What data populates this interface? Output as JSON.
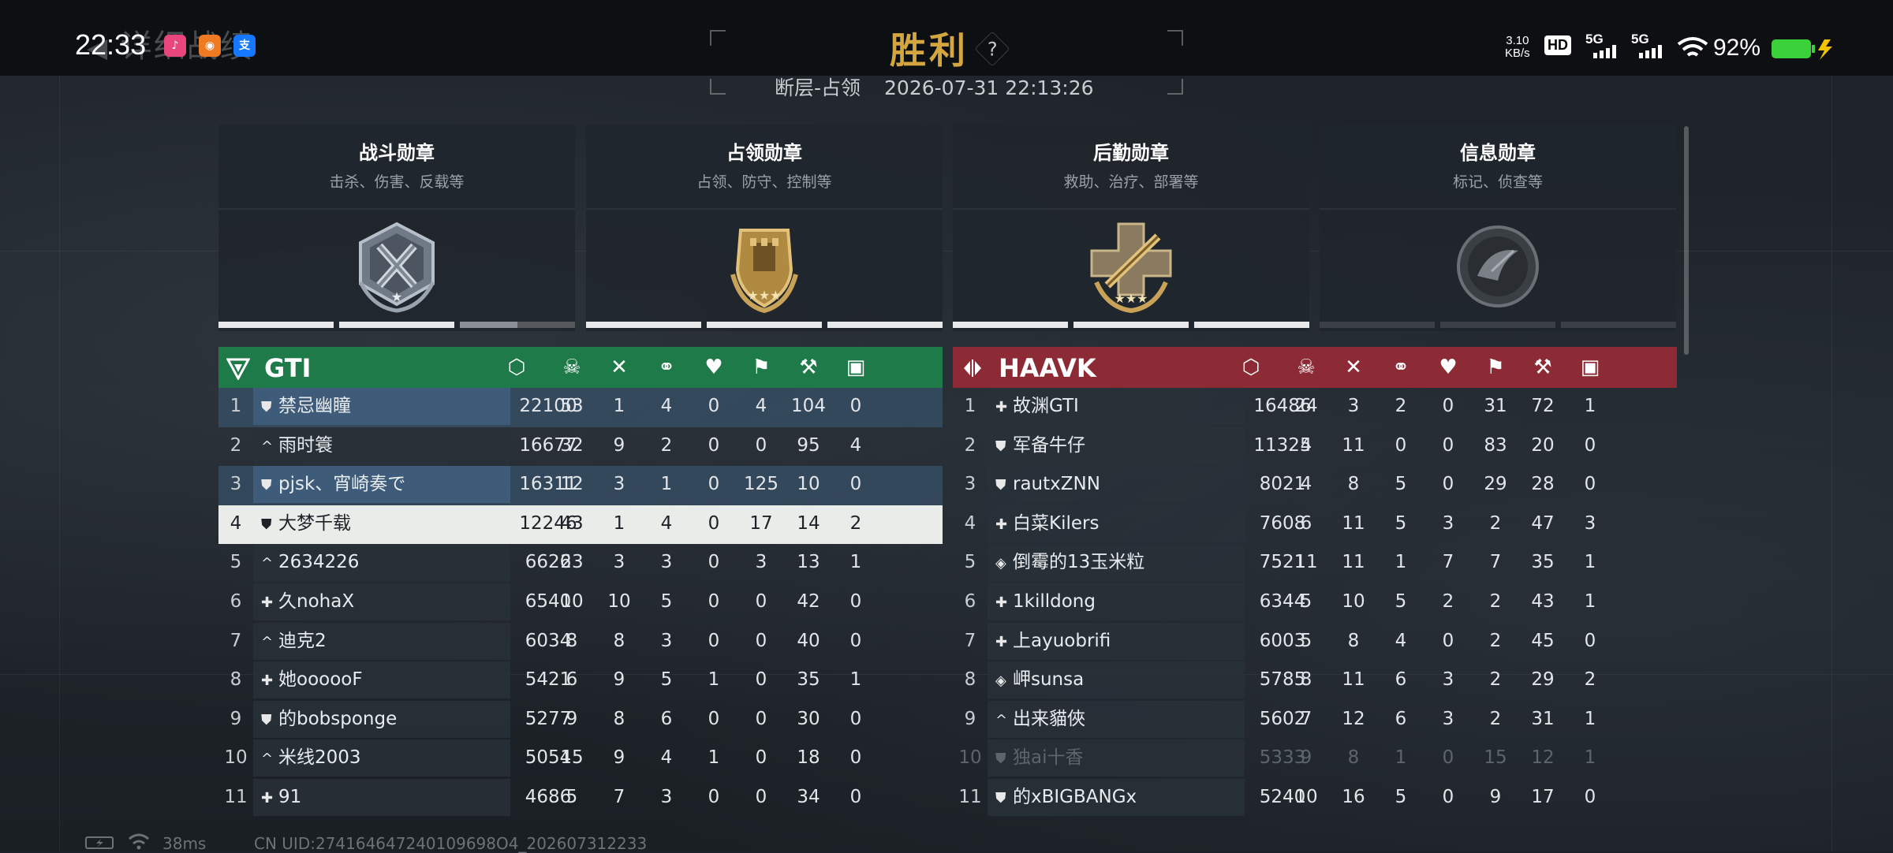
{
  "status_bar": {
    "time": "22:33",
    "speed_value": "3.10",
    "speed_unit": "KB/s",
    "hd": "HD",
    "net1": "5G",
    "net2": "5G",
    "battery": "92%"
  },
  "header": {
    "back_label": "详细战绩",
    "title": "胜利",
    "help": "?",
    "map_mode": "断层-占领",
    "datetime": "2026-07-31 22:13:26"
  },
  "medals": [
    {
      "name": "战斗勋章",
      "desc": "击杀、伤害、反载等",
      "progress": [
        1,
        1,
        0.5
      ]
    },
    {
      "name": "占领勋章",
      "desc": "占领、防守、控制等",
      "progress": [
        1,
        1,
        1
      ]
    },
    {
      "name": "后勤勋章",
      "desc": "救助、治疗、部署等",
      "progress": [
        1,
        1,
        1
      ]
    },
    {
      "name": "信息勋章",
      "desc": "标记、侦查等",
      "progress": [
        0,
        0,
        0
      ]
    }
  ],
  "stat_icons": [
    "score-icon",
    "kills-icon",
    "deaths-icon",
    "assists-icon",
    "revives-icon",
    "capture-icon",
    "objective-icon",
    "intel-icon"
  ],
  "colors": {
    "team_left": "#1f7a4a",
    "team_right": "#8c2a35",
    "title_gold": "#d4a640",
    "highlight_blue": "#3e5c7a"
  },
  "team_left": {
    "name": "GTI",
    "rows": [
      {
        "rank": "1",
        "cls": "shield",
        "name": "禁忌幽瞳",
        "stats": [
          "22100",
          "53",
          "1",
          "4",
          "0",
          "4",
          "104",
          "0"
        ],
        "hl": "blue"
      },
      {
        "rank": "2",
        "cls": "caret",
        "name": "雨时簑",
        "stats": [
          "16677",
          "32",
          "9",
          "2",
          "0",
          "0",
          "95",
          "4"
        ],
        "hl": ""
      },
      {
        "rank": "3",
        "cls": "shield",
        "name": "pjsk、宵崎奏で",
        "stats": [
          "16311",
          "12",
          "3",
          "1",
          "0",
          "125",
          "10",
          "0"
        ],
        "hl": "blue"
      },
      {
        "rank": "4",
        "cls": "shield",
        "name": "大梦千载",
        "stats": [
          "12246",
          "43",
          "1",
          "4",
          "0",
          "17",
          "14",
          "2"
        ],
        "hl": "white"
      },
      {
        "rank": "5",
        "cls": "caret",
        "name": "2634226",
        "stats": [
          "6626",
          "23",
          "3",
          "3",
          "0",
          "3",
          "13",
          "1"
        ],
        "hl": ""
      },
      {
        "rank": "6",
        "cls": "plus",
        "name": "久nohaX",
        "stats": [
          "6540",
          "10",
          "10",
          "5",
          "0",
          "0",
          "42",
          "0"
        ],
        "hl": ""
      },
      {
        "rank": "7",
        "cls": "caret",
        "name": "迪克2",
        "stats": [
          "6034",
          "8",
          "8",
          "3",
          "0",
          "0",
          "40",
          "0"
        ],
        "hl": ""
      },
      {
        "rank": "8",
        "cls": "plus",
        "name": "她oooooF",
        "stats": [
          "5421",
          "6",
          "9",
          "5",
          "1",
          "0",
          "35",
          "1"
        ],
        "hl": ""
      },
      {
        "rank": "9",
        "cls": "shield",
        "name": "的bobsponge",
        "stats": [
          "5277",
          "9",
          "8",
          "6",
          "0",
          "0",
          "30",
          "0"
        ],
        "hl": ""
      },
      {
        "rank": "10",
        "cls": "caret",
        "name": "米线2003",
        "stats": [
          "5054",
          "15",
          "9",
          "4",
          "1",
          "0",
          "18",
          "0"
        ],
        "hl": ""
      },
      {
        "rank": "11",
        "cls": "plus",
        "name": "91",
        "stats": [
          "4686",
          "5",
          "7",
          "3",
          "0",
          "0",
          "34",
          "0"
        ],
        "hl": ""
      }
    ]
  },
  "team_right": {
    "name": "HAAVK",
    "rows": [
      {
        "rank": "1",
        "cls": "plus",
        "name": "故渊GTI",
        "stats": [
          "16486",
          "24",
          "3",
          "2",
          "0",
          "31",
          "72",
          "1"
        ],
        "hl": ""
      },
      {
        "rank": "2",
        "cls": "shield",
        "name": "军备牛仔",
        "stats": [
          "11325",
          "4",
          "11",
          "0",
          "0",
          "83",
          "20",
          "0"
        ],
        "hl": ""
      },
      {
        "rank": "3",
        "cls": "shield",
        "name": "rautxZNN",
        "stats": [
          "8021",
          "4",
          "8",
          "5",
          "0",
          "29",
          "28",
          "0"
        ],
        "hl": ""
      },
      {
        "rank": "4",
        "cls": "plus",
        "name": "白菜Kilers",
        "stats": [
          "7608",
          "6",
          "11",
          "5",
          "3",
          "2",
          "47",
          "3"
        ],
        "hl": ""
      },
      {
        "rank": "5",
        "cls": "diamond",
        "name": "倒霉的13玉米粒",
        "stats": [
          "7521",
          "11",
          "11",
          "1",
          "7",
          "7",
          "35",
          "1"
        ],
        "hl": ""
      },
      {
        "rank": "6",
        "cls": "plus",
        "name": "1killdong",
        "stats": [
          "6344",
          "5",
          "10",
          "5",
          "2",
          "2",
          "43",
          "1"
        ],
        "hl": ""
      },
      {
        "rank": "7",
        "cls": "plus",
        "name": "上ayuobrifi",
        "stats": [
          "6003",
          "5",
          "8",
          "4",
          "0",
          "2",
          "45",
          "0"
        ],
        "hl": ""
      },
      {
        "rank": "8",
        "cls": "diamond",
        "name": "岬sunsa",
        "stats": [
          "5785",
          "8",
          "11",
          "6",
          "3",
          "2",
          "29",
          "2"
        ],
        "hl": ""
      },
      {
        "rank": "9",
        "cls": "caret",
        "name": "出来貓俠",
        "stats": [
          "5602",
          "7",
          "12",
          "6",
          "3",
          "2",
          "31",
          "1"
        ],
        "hl": ""
      },
      {
        "rank": "10",
        "cls": "shield",
        "name": "独ai十香",
        "stats": [
          "5333",
          "9",
          "8",
          "1",
          "0",
          "15",
          "12",
          "1"
        ],
        "hl": "dim"
      },
      {
        "rank": "11",
        "cls": "shield",
        "name": "的xBIGBANGx",
        "stats": [
          "5240",
          "10",
          "16",
          "5",
          "0",
          "9",
          "17",
          "0"
        ],
        "hl": ""
      }
    ]
  },
  "footer": {
    "ping": "38ms",
    "uid": "CN UID:274164647240109698O4_202607312233"
  }
}
